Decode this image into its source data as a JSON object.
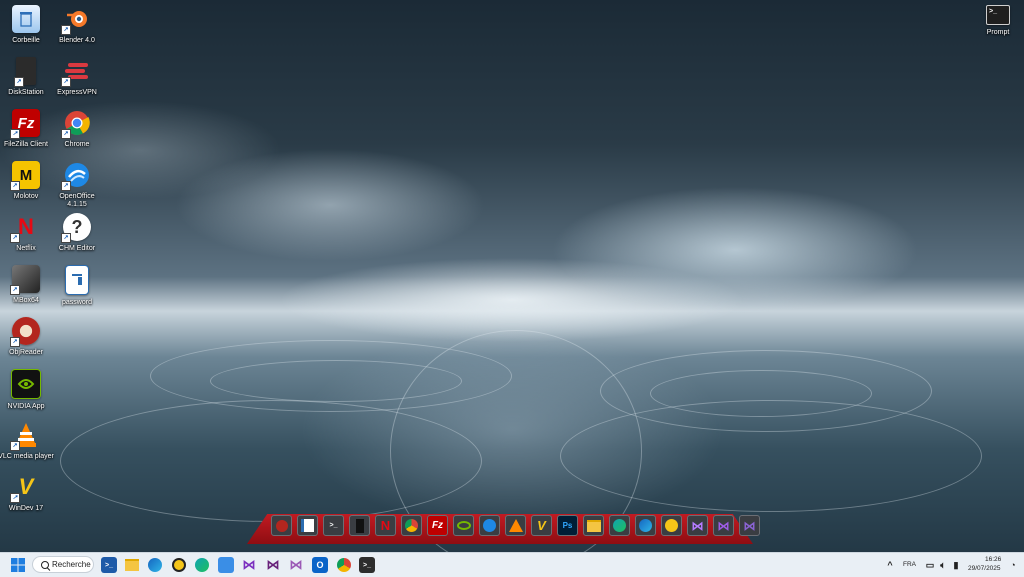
{
  "desktop": {
    "icons": [
      {
        "label": "Corbeille",
        "icon": "recycle-bin-icon"
      },
      {
        "label": "Blender 4.0",
        "icon": "blender-icon"
      },
      {
        "label": "DiskStation",
        "icon": "diskstation-icon"
      },
      {
        "label": "ExpressVPN",
        "icon": "expressvpn-icon"
      },
      {
        "label": "FileZilla Client",
        "icon": "filezilla-icon"
      },
      {
        "label": "Chrome",
        "icon": "chrome-icon"
      },
      {
        "label": "Molotov",
        "icon": "molotov-icon"
      },
      {
        "label": "OpenOffice\n4.1.15",
        "icon": "openoffice-icon"
      },
      {
        "label": "Netflix",
        "icon": "netflix-icon"
      },
      {
        "label": "CHM Editor",
        "icon": "chm-editor-icon"
      },
      {
        "label": "MBox64",
        "icon": "mbox64-icon"
      },
      {
        "label": "password",
        "icon": "document-icon"
      },
      {
        "label": "ObjReader",
        "icon": "objreader-icon"
      },
      {
        "label": "NVIDIA App",
        "icon": "nvidia-icon"
      },
      {
        "label": "VLC media player",
        "icon": "vlc-icon"
      },
      {
        "label": "WinDev 17",
        "icon": "windev-icon"
      },
      {
        "label": "Prompt",
        "icon": "terminal-icon"
      }
    ]
  },
  "dock": {
    "items": [
      {
        "icon": "objreader-icon",
        "color": "#b3261e"
      },
      {
        "icon": "document-icon",
        "color": "#2b6cb0"
      },
      {
        "icon": "terminal-icon",
        "color": "#1f1f1f"
      },
      {
        "icon": "diskstation-icon",
        "color": "#333333"
      },
      {
        "icon": "netflix-icon",
        "color": "#e50914"
      },
      {
        "icon": "chrome-icon",
        "color": "#4285f4"
      },
      {
        "icon": "filezilla-icon",
        "color": "#bf0000"
      },
      {
        "icon": "nvidia-icon",
        "color": "#76b900"
      },
      {
        "icon": "openoffice-icon",
        "color": "#1e88e5"
      },
      {
        "icon": "vlc-icon",
        "color": "#ff8800"
      },
      {
        "icon": "windev-icon",
        "color": "#f5c518"
      },
      {
        "icon": "photoshop-icon",
        "color": "#31a8ff"
      },
      {
        "icon": "file-explorer-icon",
        "color": "#f4c542"
      },
      {
        "icon": "edge-icon",
        "color": "#0fa3b1"
      },
      {
        "icon": "edge-icon",
        "color": "#1565c0"
      },
      {
        "icon": "norton-icon",
        "color": "#f5c518"
      },
      {
        "icon": "visual-studio-icon",
        "color": "#7b2fbf"
      },
      {
        "icon": "visual-studio-icon",
        "color": "#6a1b9a"
      },
      {
        "icon": "visual-studio-icon",
        "color": "#7e57c2"
      }
    ]
  },
  "taskbar": {
    "start_icon": "windows-start-icon",
    "search_placeholder": "Recherche",
    "pinned": [
      {
        "icon": "powershell-icon",
        "color": "#1e5aa8"
      },
      {
        "icon": "file-explorer-icon",
        "color": "#f4c542"
      },
      {
        "icon": "edge-icon",
        "color": "#1e88e5"
      },
      {
        "icon": "norton-icon",
        "color": "#f5c518"
      },
      {
        "icon": "edge-icon",
        "color": "#0fa3b1"
      },
      {
        "icon": "photos-icon",
        "color": "#3a8ee6"
      },
      {
        "icon": "visual-studio-icon",
        "color": "#7b2fbf"
      },
      {
        "icon": "visual-studio-icon",
        "color": "#68217a"
      },
      {
        "icon": "visual-studio-icon",
        "color": "#9b59b6"
      },
      {
        "icon": "outlook-icon",
        "color": "#0a64c8"
      },
      {
        "icon": "chrome-icon",
        "color": "#4285f4"
      },
      {
        "icon": "terminal-icon",
        "color": "#2d2d2d"
      }
    ],
    "tray": {
      "language": "FRA",
      "time": "16:26",
      "date": "29/07/2025"
    }
  }
}
